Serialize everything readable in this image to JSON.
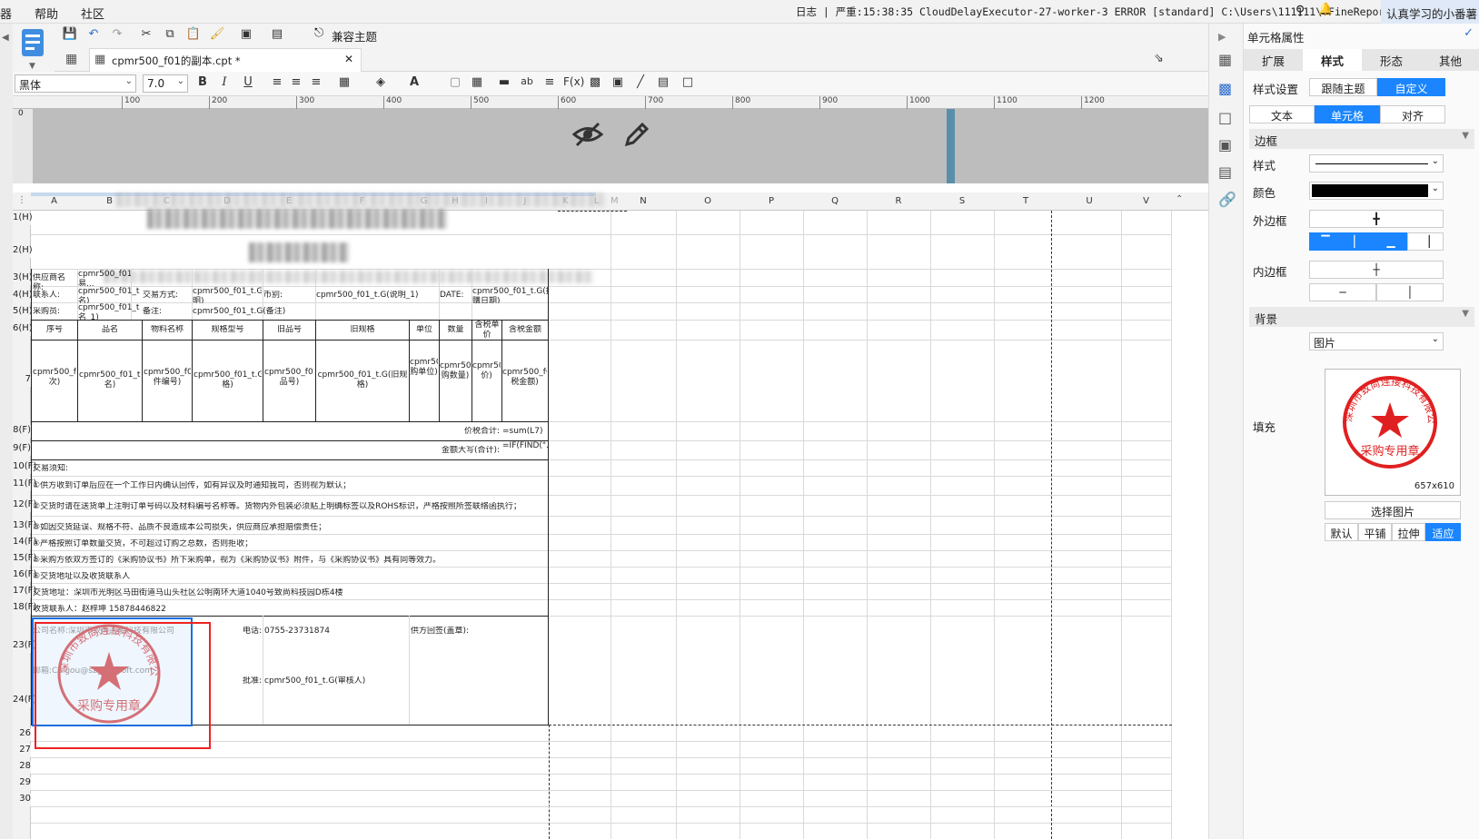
{
  "menubar": {
    "items": [
      "器",
      "帮助",
      "社区"
    ],
    "log_text": "日志 | 严重:15:38:35 CloudDelayExecutor-27-worker-3 ERROR [standard] C:\\Users\\111111\\.FineReport1...",
    "user": "认真学习的小番薯"
  },
  "toolbar": {
    "compat_theme": "兼容主题"
  },
  "tab": {
    "title": "cpmr500_f01的副本.cpt *"
  },
  "format": {
    "font": "黑体",
    "size": "7.0"
  },
  "ruler_ticks": [
    "100",
    "200",
    "300",
    "400",
    "500",
    "600",
    "700",
    "800",
    "900",
    "1000",
    "1100",
    "1200"
  ],
  "columns": [
    "A",
    "B",
    "C",
    "D",
    "E",
    "F",
    "G",
    "H",
    "I",
    "J",
    "K",
    "L",
    "M",
    "N",
    "O",
    "P",
    "Q",
    "R",
    "S",
    "T",
    "U",
    "V"
  ],
  "rows": [
    "1(H)",
    "2(H)",
    "3(H)",
    "4(H)",
    "5(H)",
    "6(H)",
    "7",
    "8(F)",
    "9(F)",
    "10(F)",
    "11(F)",
    "12(F)",
    "13(F)",
    "14(F)",
    "15(F)",
    "16(F)",
    "17(F)",
    "18(F)",
    "23(F)",
    "24(F)",
    "26",
    "27",
    "28",
    "29",
    "30"
  ],
  "sheet": {
    "r3": {
      "supplier_label": "供应商名称:",
      "supplier_val": "cpmr500_f01_t.G(交易..."
    },
    "r4": {
      "contact_label": "联系人:",
      "contact_val": "cpmr500_f01_t.G(全名)",
      "trade_label": "交易方式:",
      "trade_val": "cpmr500_f01_t.G(说明)",
      "currency_label": "币别:",
      "currency_val": "cpmr500_f01_t.G(说明_1)",
      "date_label": "DATE:",
      "date_val": "cpmr500_f01_t.G(採購日期)"
    },
    "r5": {
      "buyer_label": "采购员:",
      "buyer_val": "cpmr500_f01_t.G(全名_1)",
      "note_label": "备注:",
      "note_val": "cpmr500_f01_t.G(备注)"
    },
    "headers": [
      "序号",
      "品名",
      "物料名称",
      "规格型号",
      "旧品号",
      "旧规格",
      "单位",
      "数量",
      "含税单价",
      "含税金额"
    ],
    "r7": [
      "cpmr500_f01_t.G(项次)",
      "cpmr500_f01_t.G(品名)",
      "cpmr500_f01_t.G(料件编号)",
      "cpmr500_f01_t.G(规格)",
      "cpmr500_f01_t.G(旧品号)",
      "cpmr500_f01_t.G(旧规格)",
      "cpmr500_f01_t.G(采购单位)",
      "cpmr500_f01_t.G(采购数量)",
      "cpmr500_f01_t.G(单价)",
      "cpmr500_f01_t.G(含税金额)"
    ],
    "r8": {
      "label": "价税合计:",
      "val": "=sum(L7)"
    },
    "r9": {
      "label": "金额大写(合计):",
      "val": "=IF(FIND(\".\",L8)"
    },
    "notes": [
      "交易须知:",
      "①供方收到订单后应在一个工作日内确认回传，如有异议及时通知我司，否则视为默认；",
      "②交货时请在送货单上注明订单号码以及材料编号名称等。货物内外包装必须贴上明确标签以及ROHS标识，严格按照所签联络函执行；",
      "③如因交货延误、规格不符、品质不良造成本公司损失，供应商应承担赔偿责任；",
      "④严格按照订单数量交货，不可超过订购之总数，否则拒收；",
      "⑤采购方依双方签订的《采购协议书》所下采购单，视为《采购协议书》附件，与《采购协议书》具有同等效力。",
      "⑥交货地址以及收货联系人",
      "交货地址：深圳市光明区马田街道马山头社区公明南环大道1040号致尚科技园D栋4楼",
      "收货联系人：赵梓坤 15878446822"
    ],
    "sign": {
      "company": "公司名称:深圳市致尚连接科技有限公司",
      "mail": "邮箱:Caigou@szgoodsoft.com",
      "phone_label": "电话:",
      "phone": "0755-23731874",
      "reply": "供方回签(盖章):",
      "approve_label": "批准:",
      "approve": "cpmr500_f01_t.G(审核人)"
    },
    "stamp_text": "深圳市致尚连接科技有限公司",
    "stamp_sub": "采购专用章"
  },
  "props": {
    "title": "单元格属性",
    "tabs": [
      "扩展",
      "样式",
      "形态",
      "其他"
    ],
    "style_setting": "样式设置",
    "follow_theme": "跟随主题",
    "custom": "自定义",
    "subtabs": [
      "文本",
      "单元格",
      "对齐"
    ],
    "border_section": "边框",
    "style_label": "样式",
    "color_label": "颜色",
    "outer_border": "外边框",
    "inner_border": "内边框",
    "bg_section": "背景",
    "bg_type": "图片",
    "fill_label": "填充",
    "img_size": "657x610",
    "choose_img": "选择图片",
    "fit_modes": [
      "默认",
      "平铺",
      "拉伸",
      "适应"
    ]
  }
}
